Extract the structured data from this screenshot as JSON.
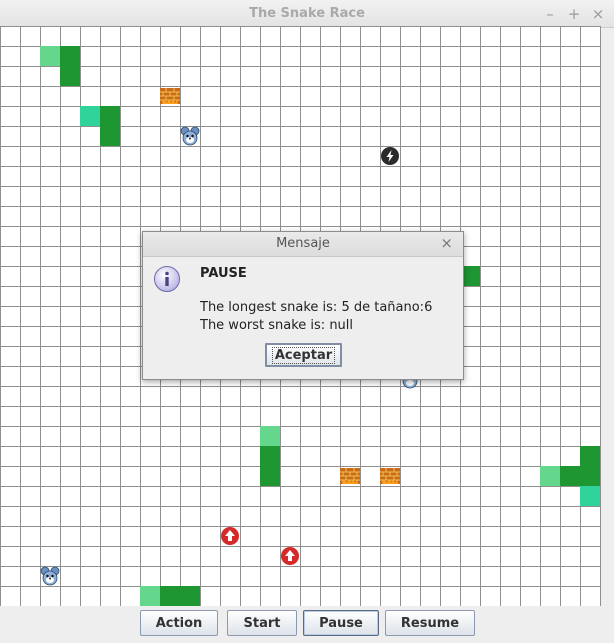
{
  "window": {
    "title": "The Snake Race",
    "minimize": "–",
    "maximize": "+",
    "close": "×"
  },
  "colors": {
    "snake_body": "#1e9632",
    "snake_head": "#64d78c",
    "snake_head_alt": "#30d39a",
    "grid_line": "#8f8f8f",
    "arrow_item": "#d42a2a"
  },
  "board_icons": [
    "fire-block-icon",
    "mouse-icon",
    "lightning-icon",
    "up-arrow-icon"
  ],
  "dialog": {
    "title": "Mensaje",
    "close": "×",
    "heading": "PAUSE",
    "line1": "The longest snake is: 5 de tañano:6",
    "line2": "The worst snake is: null",
    "ok_label": "Aceptar"
  },
  "buttons": {
    "action": "Action",
    "start": "Start",
    "pause": "Pause",
    "resume": "Resume"
  }
}
